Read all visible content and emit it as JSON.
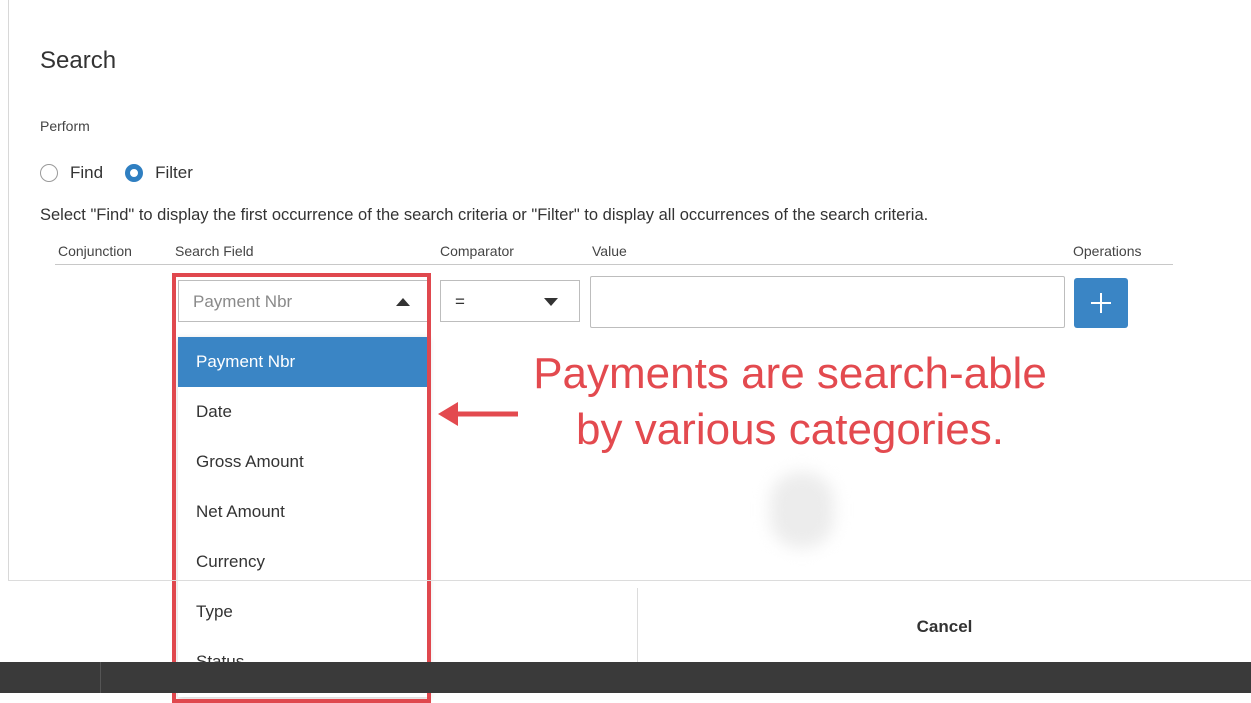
{
  "dialog": {
    "title": "Search",
    "perform_label": "Perform",
    "radio_find": "Find",
    "radio_filter": "Filter",
    "selected": "Filter",
    "hint": "Select \"Find\" to display the first occurrence of the search criteria or \"Filter\" to display all occurrences of the search criteria."
  },
  "columns": {
    "conjunction": "Conjunction",
    "search_field": "Search Field",
    "comparator": "Comparator",
    "value": "Value",
    "operations": "Operations"
  },
  "row": {
    "search_field_value": "Payment Nbr",
    "comparator_value": "=",
    "value_input": ""
  },
  "dropdown": {
    "items": [
      "Payment Nbr",
      "Date",
      "Gross Amount",
      "Net Amount",
      "Currency",
      "Type",
      "Status"
    ],
    "selected_index": 0
  },
  "annotation": {
    "line1": "Payments are search-able",
    "line2": "by various categories.",
    "color": "#e34a4f"
  },
  "footer": {
    "cancel_label": "Cancel"
  },
  "colors": {
    "accent": "#3a85c5",
    "annotation_red": "#e0484e"
  }
}
